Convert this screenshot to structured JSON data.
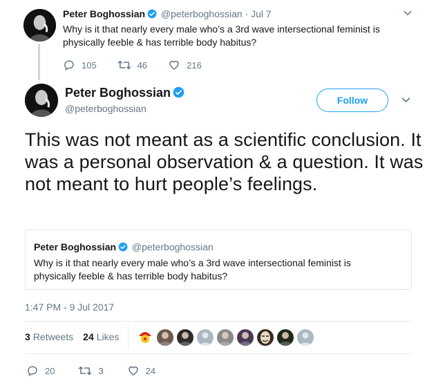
{
  "parent_tweet": {
    "name": "Peter Boghossian",
    "handle": "@peterboghossian",
    "separator": "·",
    "date": "Jul 7",
    "text": "Why is it that nearly every male who’s a 3rd wave intersectional feminist is physically feeble & has terrible body habitus?",
    "replies": "105",
    "retweets": "46",
    "likes": "216"
  },
  "main_tweet": {
    "name": "Peter Boghossian",
    "handle": "@peterboghossian",
    "follow_label": "Follow",
    "text": "This was not meant as a scientific conclusion. It was a personal observation & a question. It was not meant to hurt people’s feelings.",
    "timestamp": "1:47 PM - 9 Jul 2017",
    "stats": {
      "retweets_count": "3",
      "retweets_label": "Retweets",
      "likes_count": "24",
      "likes_label": "Likes"
    },
    "actions": {
      "replies": "20",
      "retweets": "3",
      "likes": "24"
    }
  },
  "quoted_tweet": {
    "name": "Peter Boghossian",
    "handle": "@peterboghossian",
    "text": "Why is it that nearly every male who’s a 3rd wave intersectional feminist is physically feeble & has terrible body habitus?"
  },
  "liker_avatars": [
    {
      "icon": "clown-avatar",
      "color": "#f5c518"
    },
    {
      "icon": "person-avatar",
      "color": "#6b5a4e"
    },
    {
      "icon": "person-avatar",
      "color": "#2b2b2b"
    },
    {
      "icon": "default-egg-avatar",
      "color": "#aab8c2"
    },
    {
      "icon": "person-avatar",
      "color": "#8a8a8a"
    },
    {
      "icon": "person-avatar",
      "color": "#4a3a5a"
    },
    {
      "icon": "masked-avatar",
      "color": "#3a2a20"
    },
    {
      "icon": "person-avatar",
      "color": "#1f2a1a"
    },
    {
      "icon": "default-egg-avatar",
      "color": "#aab8c2"
    }
  ],
  "colors": {
    "accent": "#1da1f2",
    "muted_text": "#657786",
    "border": "#e1e8ed",
    "thread_line": "#ccd6dd"
  },
  "icons": [
    "verified-badge-icon",
    "reply-icon",
    "retweet-icon",
    "heart-icon",
    "chevron-down-icon"
  ]
}
